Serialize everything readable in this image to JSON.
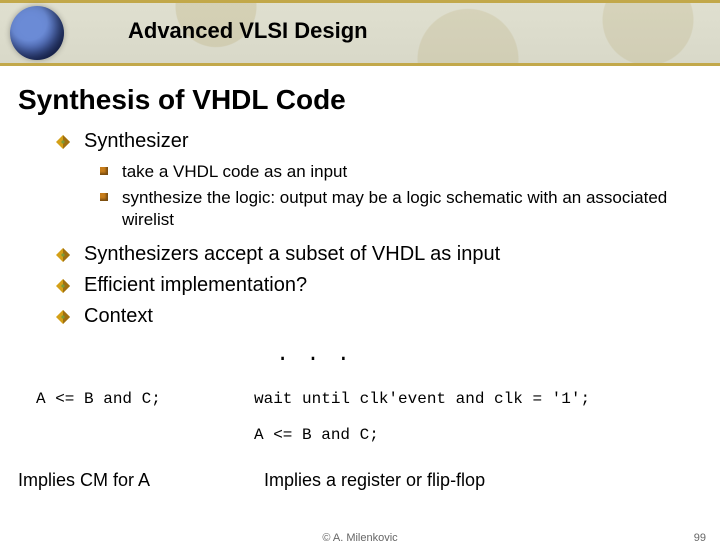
{
  "header": {
    "course_title": "Advanced VLSI Design"
  },
  "slide": {
    "title": "Synthesis of VHDL Code"
  },
  "bullets": {
    "b1": "Synthesizer",
    "b1_sub1": "take a VHDL code as an input",
    "b1_sub2": "synthesize the logic: output may be a logic schematic with an associated wirelist",
    "b2": "Synthesizers accept a subset of VHDL as input",
    "b3": "Efficient implementation?",
    "b4": "Context"
  },
  "code": {
    "ellipsis": ". . .",
    "left": "A <= B and C;",
    "right1": "wait until clk'event and clk = '1';",
    "right2": "A <= B and C;"
  },
  "implication": {
    "left": "Implies CM for A",
    "right": "Implies a register or flip-flop"
  },
  "footer": {
    "author": "© A. Milenkovic",
    "page": "99"
  },
  "colors": {
    "accent": "#c2a84a",
    "bullet_orange": "#c77d1a"
  }
}
